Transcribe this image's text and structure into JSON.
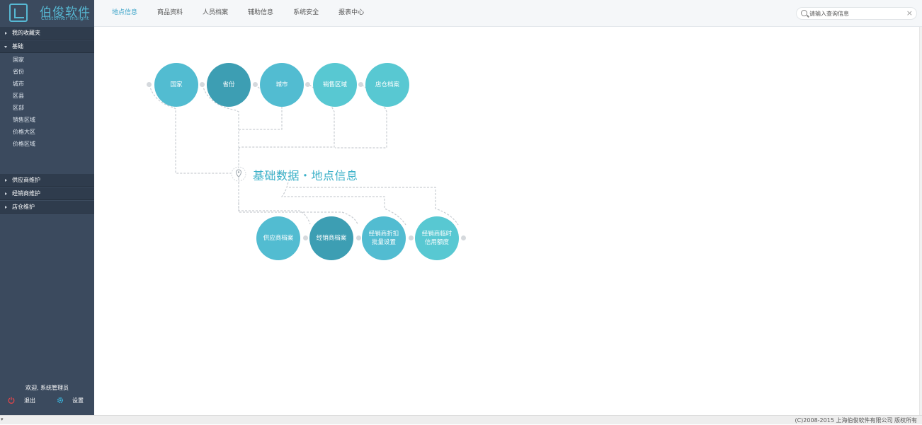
{
  "header": {
    "brand_name": "伯俊软件",
    "brand_tagline": "Customer Insight",
    "nav": [
      {
        "label": "地点信息",
        "active": true
      },
      {
        "label": "商品资料",
        "active": false
      },
      {
        "label": "人员档案",
        "active": false
      },
      {
        "label": "辅助信息",
        "active": false
      },
      {
        "label": "系统安全",
        "active": false
      },
      {
        "label": "报表中心",
        "active": false
      }
    ],
    "search": {
      "placeholder": "请输入查询信息",
      "value": ""
    },
    "search_clear": "×"
  },
  "sidebar": {
    "groups": [
      {
        "label": "我的收藏夹",
        "expanded": false
      },
      {
        "label": "基础",
        "expanded": true,
        "items": [
          "国家",
          "省份",
          "城市",
          "区县",
          "区部",
          "销售区域",
          "价格大区",
          "价格区域"
        ]
      },
      {
        "label": "供应商维护",
        "expanded": false
      },
      {
        "label": "经销商维护",
        "expanded": false
      },
      {
        "label": "店仓维护",
        "expanded": false
      }
    ],
    "welcome": "欢迎, 系统管理员",
    "logout_label": "退出",
    "settings_label": "设置"
  },
  "diagram": {
    "title": "基础数据・地点信息",
    "top_nodes": [
      {
        "label": "国家",
        "color": "#52bcd1"
      },
      {
        "label": "省份",
        "color": "#3d9eb3"
      },
      {
        "label": "城市",
        "color": "#52bcd1"
      },
      {
        "label": "销售区域",
        "color": "#58c8d2"
      },
      {
        "label": "店仓档案",
        "color": "#58c8d2"
      }
    ],
    "bottom_nodes": [
      {
        "label": "供应商档案",
        "color": "#52bcd1"
      },
      {
        "label": "经销商档案",
        "color": "#3d9eb3"
      },
      {
        "label": "经销商折扣\n批量设置",
        "color": "#52bcd1"
      },
      {
        "label": "经销商临时\n信用额度",
        "color": "#58c8d2"
      }
    ],
    "line_color": "#c9cdd2"
  },
  "footer": {
    "copyright": "(C)2008-2015 上海伯俊软件有限公司 版权所有",
    "corner_mark": "▾"
  }
}
